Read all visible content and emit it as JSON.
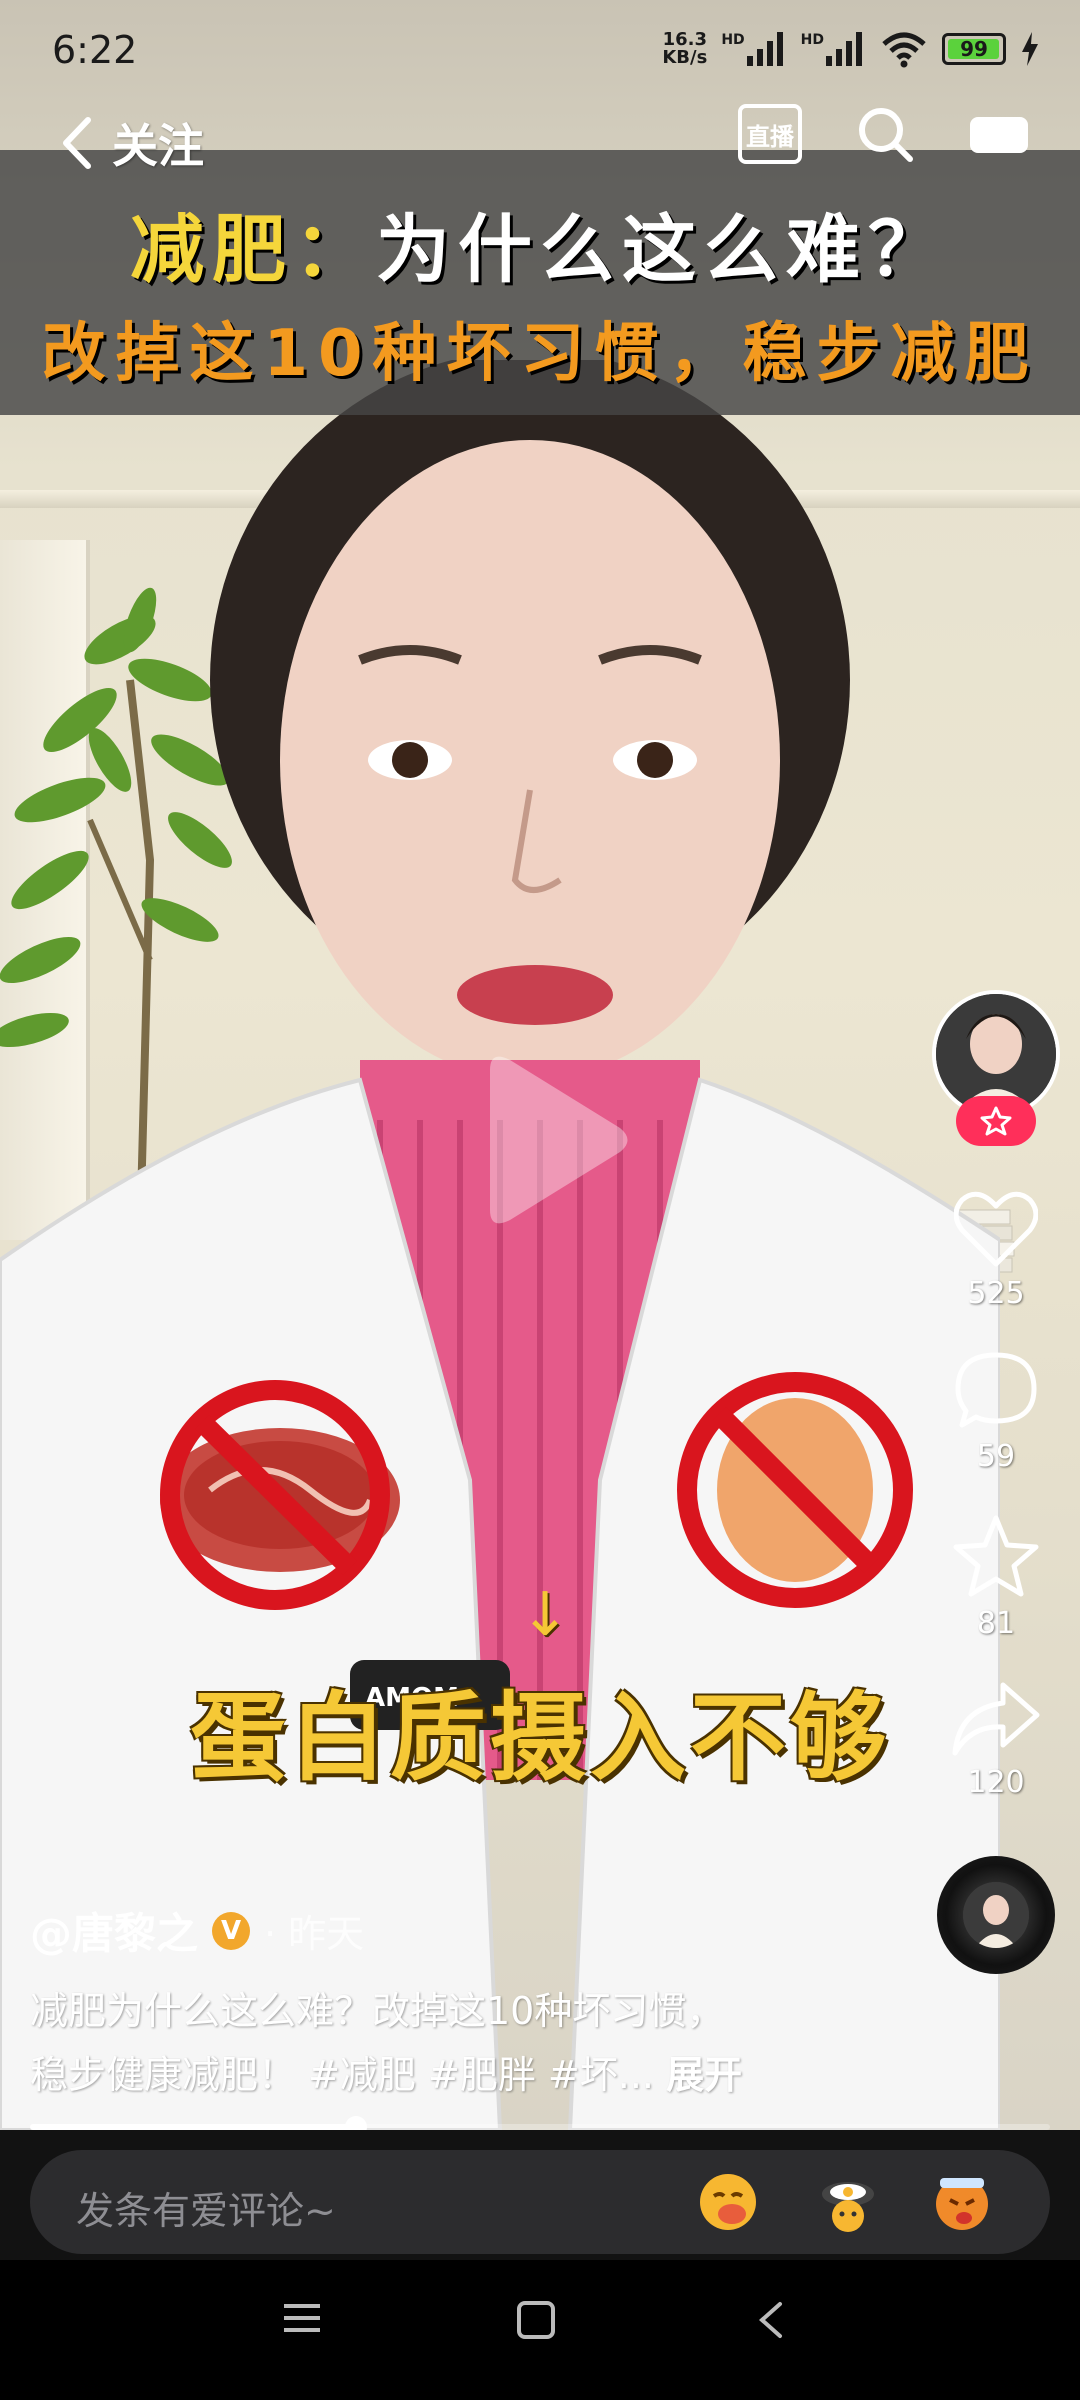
{
  "status_bar": {
    "time": "6:22",
    "net_speed_value": "16.3",
    "net_speed_unit": "KB/s",
    "hd1": "HD",
    "hd2": "HD",
    "battery": "99"
  },
  "top_nav": {
    "back_label": "关注",
    "live_label": "直播"
  },
  "title_banner": {
    "line1_accent": "减肥：",
    "line1_rest": "为什么这么难？",
    "line2": "改掉这10种坏习惯，稳步减肥"
  },
  "video": {
    "subtitle": "蛋白质摄入不够",
    "arrow": "↓",
    "playback_progress": 0.32
  },
  "right_rail": {
    "likes": "525",
    "comments": "59",
    "favorites": "81",
    "shares": "120"
  },
  "post": {
    "author": "@唐黎之",
    "verified_mark": "V",
    "time_ago": "· 昨天",
    "desc_line1": "减肥为什么这么难？改掉这10种坏习惯，",
    "desc_line2": "稳步健康减肥！ #减肥 #肥胖 #坏...",
    "expand_label": "展开"
  },
  "comment_bar": {
    "placeholder": "发条有爱评论~"
  },
  "colors": {
    "accent_yellow": "#f5d63b",
    "accent_orange": "#f39a1f",
    "follow_red": "#ff2f5a",
    "ban_red": "#d9151e"
  }
}
